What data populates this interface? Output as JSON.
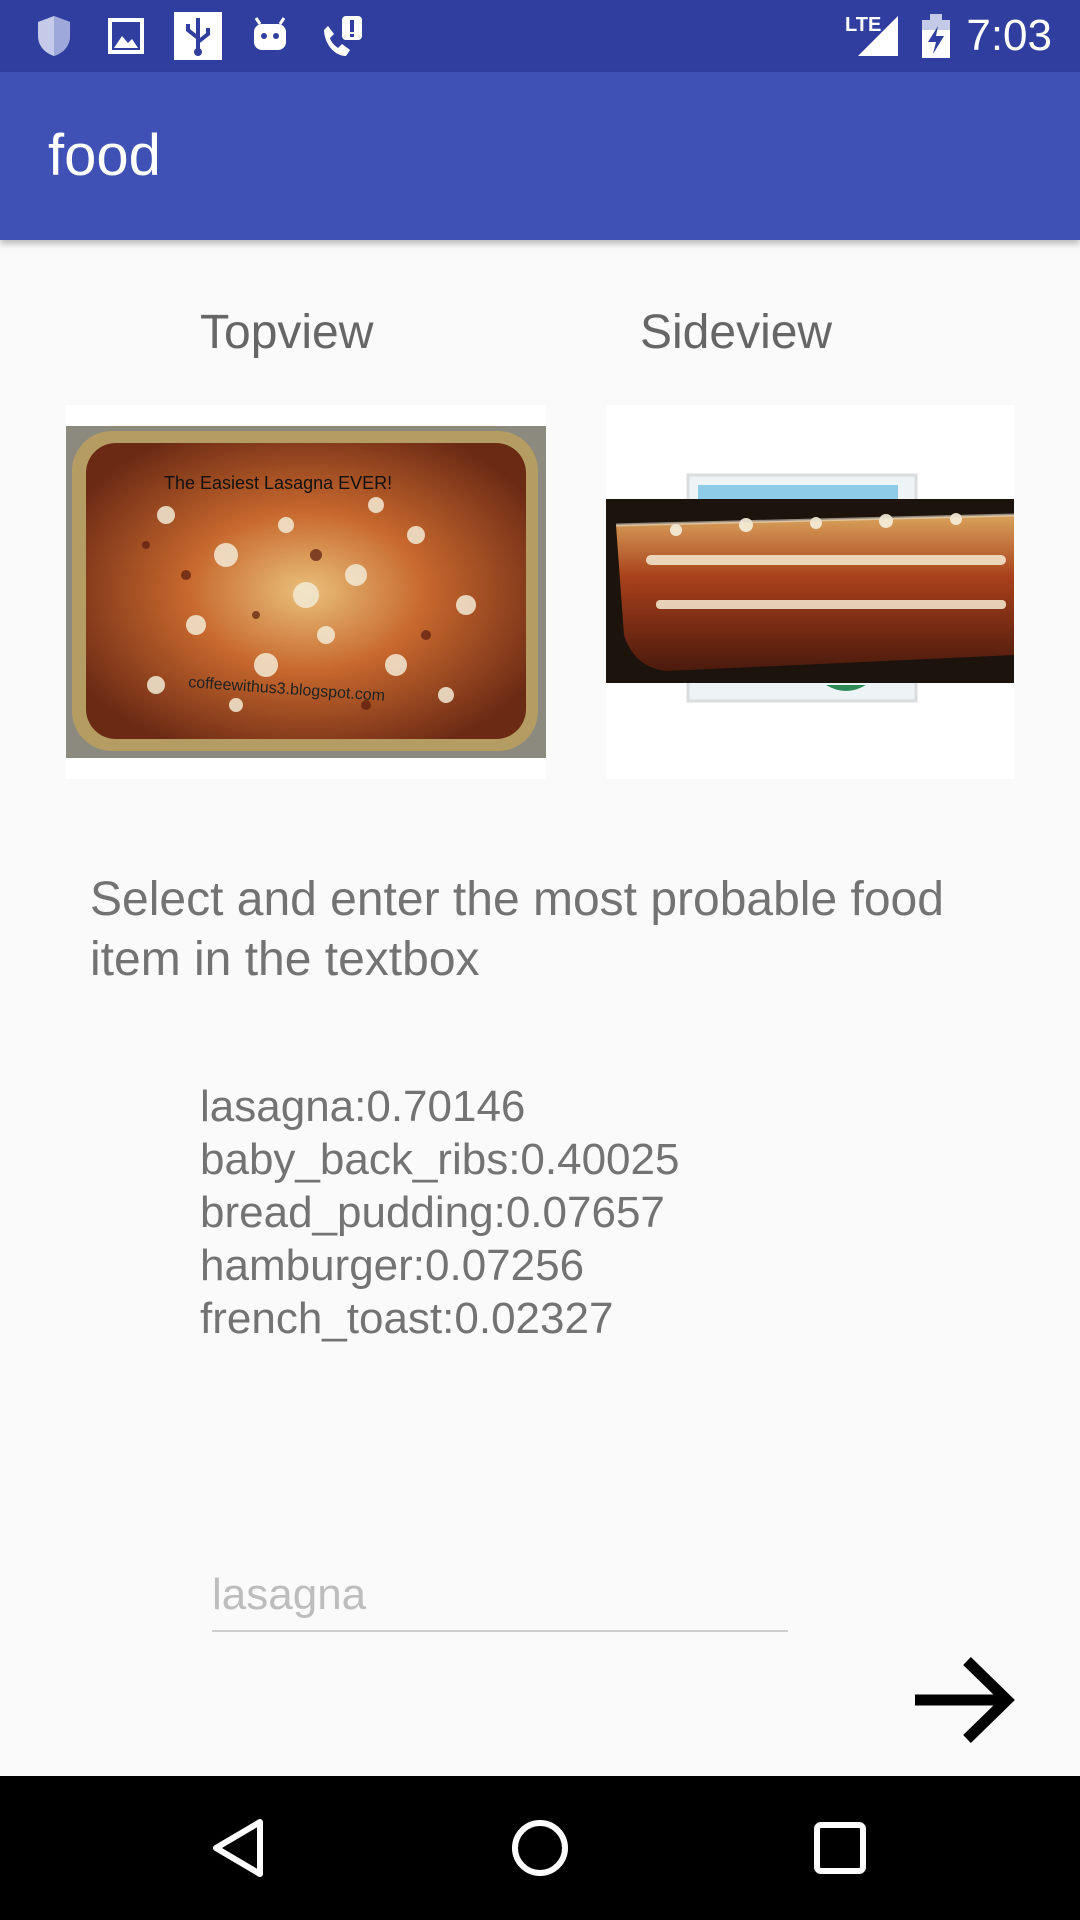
{
  "status_bar": {
    "time": "7:03",
    "network_label": "LTE",
    "icons": [
      "shield-icon",
      "image-icon",
      "usb-icon",
      "android-icon",
      "phone-alert-icon",
      "signal-icon",
      "battery-charging-icon"
    ]
  },
  "app_bar": {
    "title": "food"
  },
  "views": {
    "top_label": "Topview",
    "side_label": "Sideview",
    "top_image_caption": "The Easiest Lasagna EVER!",
    "top_image_watermark": "coffeewithus3.blogspot.com"
  },
  "instruction": "Select and enter the most probable food item in the textbox",
  "predictions": [
    "lasagna:0.70146",
    "baby_back_ribs:0.40025",
    "bread_pudding:0.07657",
    "hamburger:0.07256",
    "french_toast:0.02327"
  ],
  "input": {
    "placeholder": "lasagna",
    "value": ""
  },
  "next_button": {
    "icon": "arrow-right-icon"
  },
  "nav_bar": {
    "icons": [
      "back-icon",
      "home-icon",
      "recents-icon"
    ]
  },
  "colors": {
    "status_bar": "#303f9f",
    "app_bar": "#3f51b5",
    "background": "#fafafa"
  }
}
